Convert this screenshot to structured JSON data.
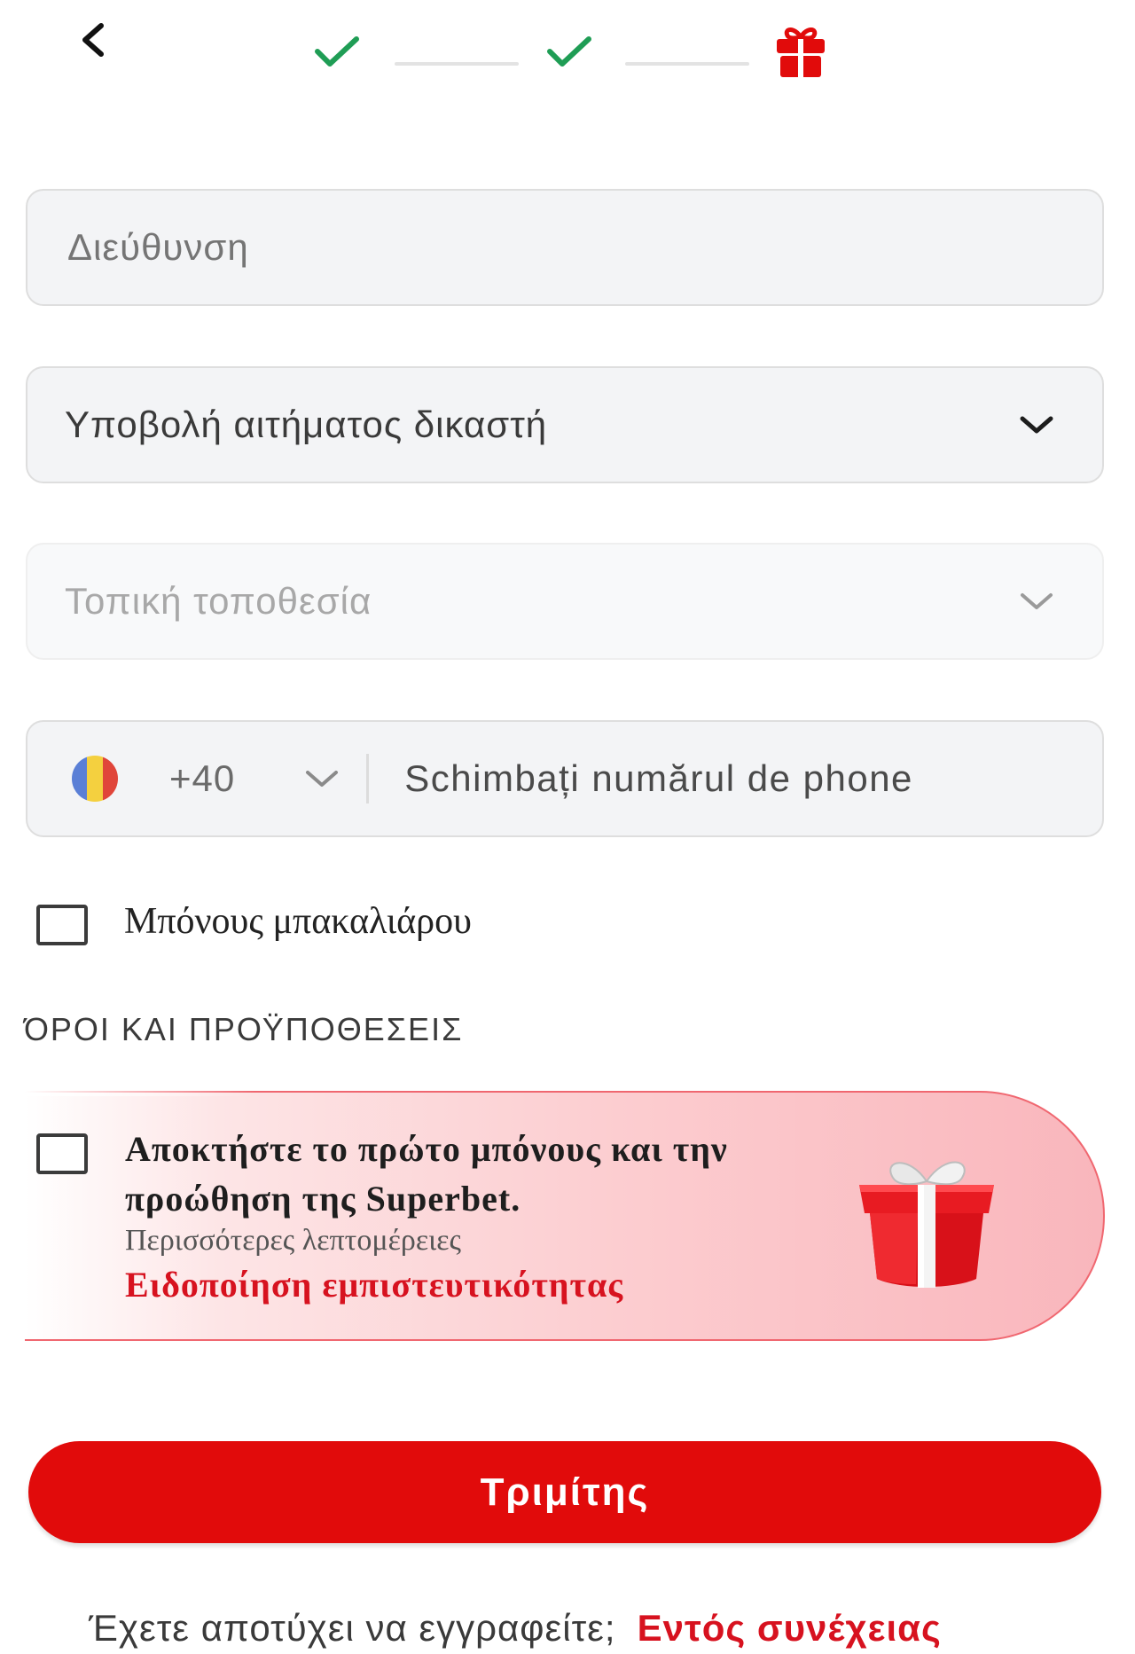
{
  "header": {
    "back_icon": "chevron-left-icon",
    "steps": [
      {
        "status": "done",
        "icon": "check-icon"
      },
      {
        "status": "done",
        "icon": "check-icon"
      },
      {
        "status": "current",
        "icon": "gift-icon"
      }
    ],
    "colors": {
      "done": "#1f9d55",
      "current": "#e10b0b",
      "line": "#e3e3e3"
    }
  },
  "form": {
    "address_placeholder": "Διεύθυνση",
    "judge_request_label": "Υποβολή αιτήματος δικαστή",
    "location_label": "Τοπική τοποθεσία",
    "phone": {
      "flag_icon": "romania-flag-icon",
      "country_code": "+40",
      "placeholder": "Schimbați numărul de phone"
    },
    "bachelor_bonus_label": "Μπόνους μπακαλιάρου"
  },
  "terms": {
    "heading": "ΌΡΟΙ ΚΑΙ ΠΡΟΫΠΟΘΕΣΕΙΣ"
  },
  "promo": {
    "title": "Αποκτήστε το πρώτο μπόνους και την προώθηση της Superbet.",
    "details_text": "Περισσότερες λεπτομέρειες",
    "privacy_link": "Ειδοποίηση εμπιστευτικότητας",
    "gift_icon": "gift-box-icon"
  },
  "actions": {
    "submit_label": "Τριμίτης",
    "footer_question": "Έχετε αποτύχει να εγγραφείτε;",
    "footer_link": "Εντός συνέχειας"
  },
  "colors": {
    "brand_red": "#e10b0b",
    "field_bg": "#f3f4f6"
  }
}
